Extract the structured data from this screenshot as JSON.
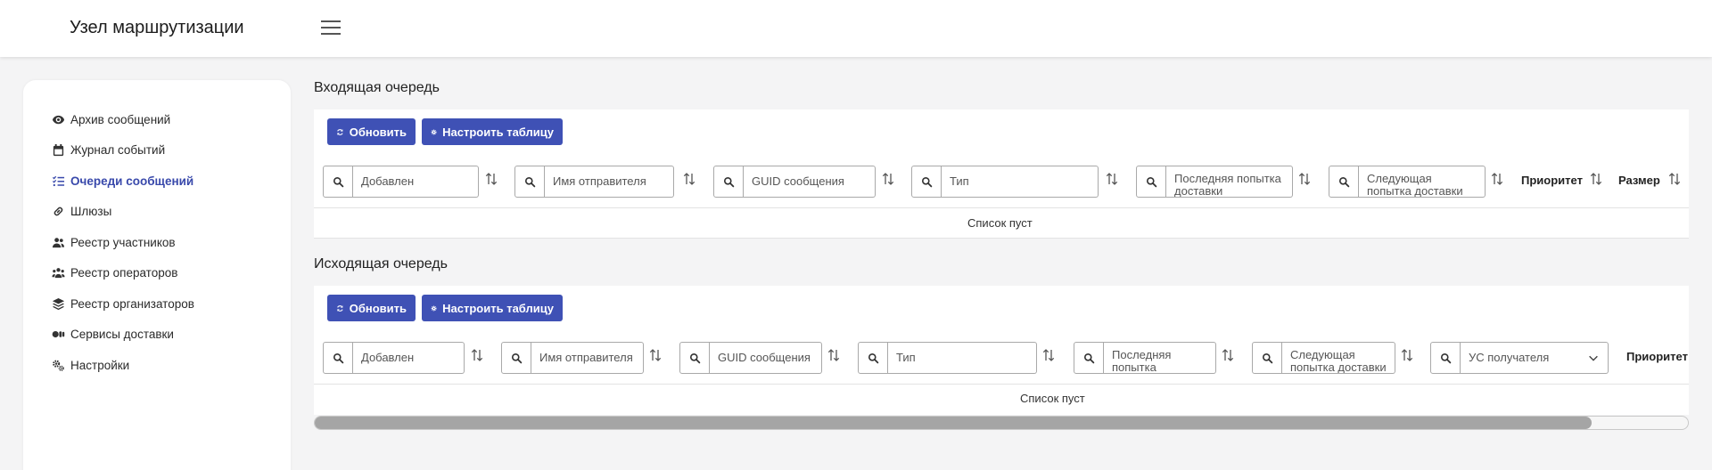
{
  "header": {
    "title": "Узел маршрутизации",
    "menu_icon": "hamburger-menu-icon"
  },
  "sidebar": {
    "items": [
      {
        "label": "Архив сообщений",
        "icon": "eye-icon",
        "active": false
      },
      {
        "label": "Журнал событий",
        "icon": "calendar-icon",
        "active": false
      },
      {
        "label": "Очереди сообщений",
        "icon": "list-check-icon",
        "active": true
      },
      {
        "label": "Шлюзы",
        "icon": "link-icon",
        "active": false
      },
      {
        "label": "Реестр участников",
        "icon": "users-icon",
        "active": false
      },
      {
        "label": "Реестр операторов",
        "icon": "users-group-icon",
        "active": false
      },
      {
        "label": "Реестр организаторов",
        "icon": "layers-icon",
        "active": false
      },
      {
        "label": "Сервисы доставки",
        "icon": "shapes-icon",
        "active": false
      },
      {
        "label": "Настройки",
        "icon": "gears-icon",
        "active": false
      }
    ]
  },
  "incoming": {
    "title": "Входящая очередь",
    "refresh_label": "Обновить",
    "configure_label": "Настроить таблицу",
    "filters": [
      {
        "placeholder": "Добавлен"
      },
      {
        "placeholder": "Имя отправителя"
      },
      {
        "placeholder": "GUID сообщения"
      },
      {
        "placeholder": "Тип"
      },
      {
        "placeholder": "Последняя попытка доставки"
      },
      {
        "placeholder": "Следующая попытка доставки"
      }
    ],
    "columns": [
      "Приоритет",
      "Размер"
    ],
    "empty_text": "Список пуст"
  },
  "outgoing": {
    "title": "Исходящая очередь",
    "refresh_label": "Обновить",
    "configure_label": "Настроить таблицу",
    "filters": [
      {
        "placeholder": "Добавлен"
      },
      {
        "placeholder": "Имя отправителя"
      },
      {
        "placeholder": "GUID сообщения"
      },
      {
        "placeholder": "Тип"
      },
      {
        "placeholder": "Последняя попытка доставки"
      },
      {
        "placeholder": "Следующая попытка доставки"
      },
      {
        "placeholder": "УС получателя"
      }
    ],
    "columns": [
      "Приоритет"
    ],
    "empty_text": "Список пуст"
  },
  "horizontal_scroll": {
    "position": 0,
    "visible_fraction": 0.93
  },
  "colors": {
    "accent": "#3f51b5",
    "active_nav": "#3949ab",
    "background": "#f4f4f5"
  }
}
